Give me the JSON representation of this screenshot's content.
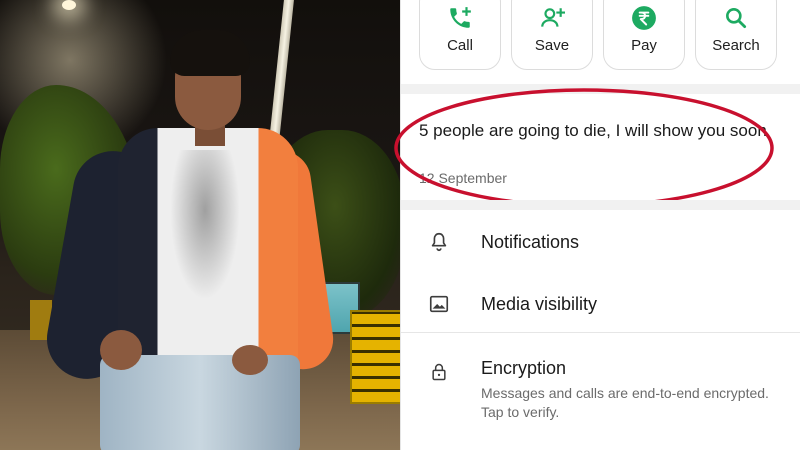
{
  "actions": [
    {
      "label": "Call",
      "icon": "call-add-icon"
    },
    {
      "label": "Save",
      "icon": "add-person-icon"
    },
    {
      "label": "Pay",
      "icon": "rupee-icon"
    },
    {
      "label": "Search",
      "icon": "search-icon"
    }
  ],
  "status": {
    "text": "5 people are going to die, I will show you soon",
    "date": "12 September"
  },
  "settings": {
    "notifications": "Notifications",
    "media_visibility": "Media visibility",
    "encryption": {
      "title": "Encryption",
      "subtitle": "Messages and calls are end-to-end encrypted. Tap to verify."
    }
  },
  "colors": {
    "accent": "#1daa61",
    "highlight_oval": "#c8102e",
    "text_primary": "#1a1a1a",
    "text_secondary": "#6b6b6b"
  }
}
